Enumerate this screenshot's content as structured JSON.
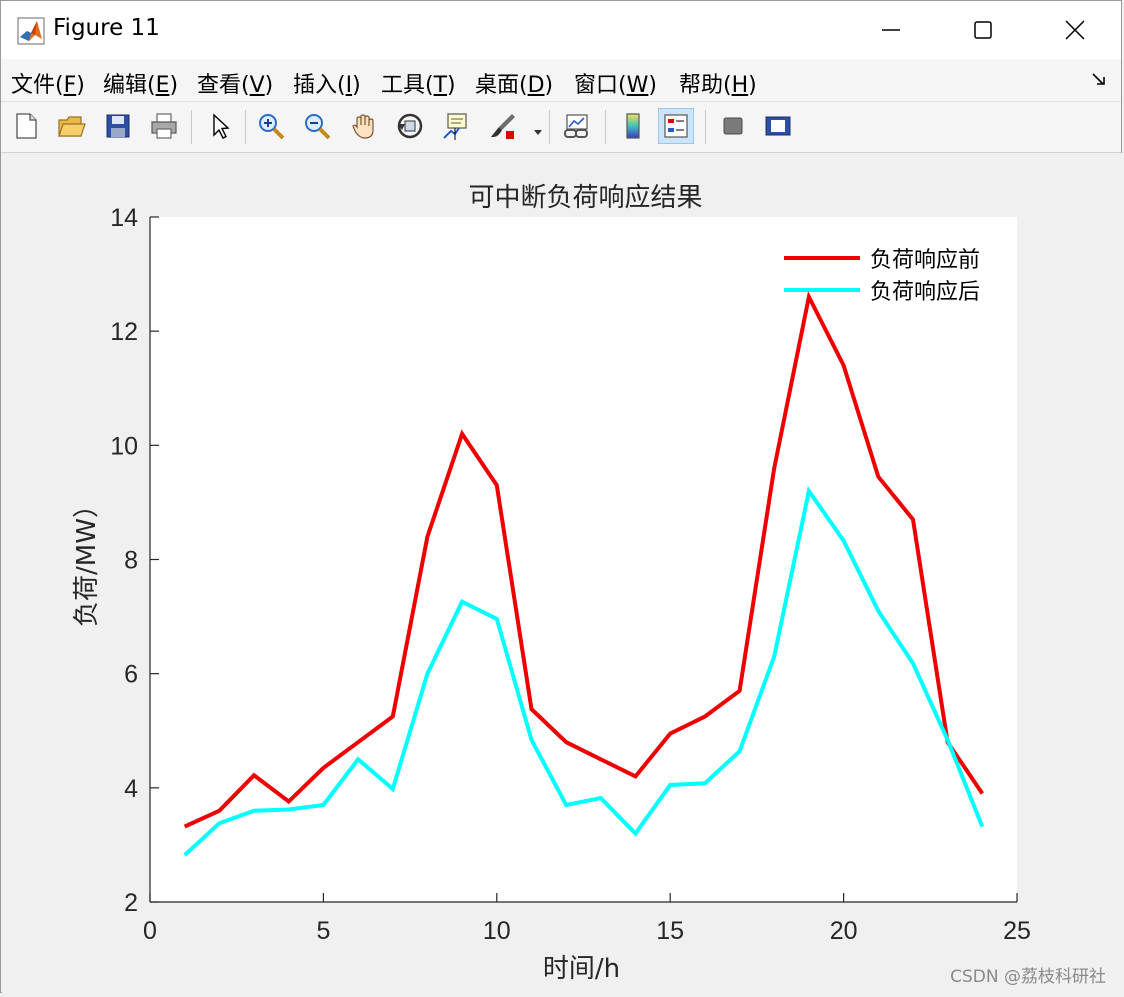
{
  "window": {
    "title": "Figure 11",
    "minimize_label": "—",
    "maximize_label": "☐",
    "close_label": "✕"
  },
  "menu": [
    {
      "text": "文件(",
      "key": "F",
      "after": ")"
    },
    {
      "text": "编辑(",
      "key": "E",
      "after": ")"
    },
    {
      "text": "查看(",
      "key": "V",
      "after": ")"
    },
    {
      "text": "插入(",
      "key": "I",
      "after": ")"
    },
    {
      "text": "工具(",
      "key": "T",
      "after": ")"
    },
    {
      "text": "桌面(",
      "key": "D",
      "after": ")"
    },
    {
      "text": "窗口(",
      "key": "W",
      "after": ")"
    },
    {
      "text": "帮助(",
      "key": "H",
      "after": ")"
    }
  ],
  "toolbar": [
    "new-figure-icon",
    "open-file-icon",
    "save-icon",
    "print-icon",
    "pointer-icon",
    "zoom-in-icon",
    "zoom-out-icon",
    "pan-hand-icon",
    "rotate-3d-icon",
    "data-cursor-icon",
    "brush-icon",
    "link-plot-icon",
    "colorbar-icon",
    "legend-icon",
    "hide-plot-tools-icon",
    "show-plot-tools-icon"
  ],
  "watermark": "CSDN @荔枝科研社",
  "colors": {
    "before": "#ee0000",
    "after": "#00ffff",
    "axes_bg": "#ffffff",
    "figure_bg": "#f0f0f0"
  },
  "chart_data": {
    "type": "line",
    "title": "可中断负荷响应结果",
    "xlabel": "时间/h",
    "ylabel": "负荷/MW）",
    "xlim": [
      0,
      25
    ],
    "ylim": [
      2,
      14
    ],
    "xticks": [
      0,
      5,
      10,
      15,
      20,
      25
    ],
    "yticks": [
      2,
      4,
      6,
      8,
      10,
      12,
      14
    ],
    "grid": false,
    "legend_position": "top-right",
    "x": [
      1,
      2,
      3,
      4,
      5,
      6,
      7,
      8,
      9,
      10,
      11,
      12,
      13,
      14,
      15,
      16,
      17,
      18,
      19,
      20,
      21,
      22,
      23,
      24
    ],
    "series": [
      {
        "name": "负荷响应前",
        "color": "#ee0000",
        "values": [
          3.32,
          3.6,
          4.22,
          3.76,
          4.35,
          4.8,
          5.25,
          8.4,
          10.2,
          9.3,
          5.38,
          4.8,
          4.5,
          4.2,
          4.95,
          5.25,
          5.7,
          9.6,
          12.6,
          11.4,
          9.45,
          8.7,
          4.8,
          3.9
        ]
      },
      {
        "name": "负荷响应后",
        "color": "#00ffff",
        "values": [
          2.82,
          3.38,
          3.6,
          3.62,
          3.7,
          4.5,
          3.98,
          6.0,
          7.26,
          6.96,
          4.84,
          3.7,
          3.82,
          3.2,
          4.05,
          4.08,
          4.64,
          6.3,
          9.2,
          8.33,
          7.1,
          6.18,
          4.84,
          3.32
        ]
      }
    ]
  }
}
